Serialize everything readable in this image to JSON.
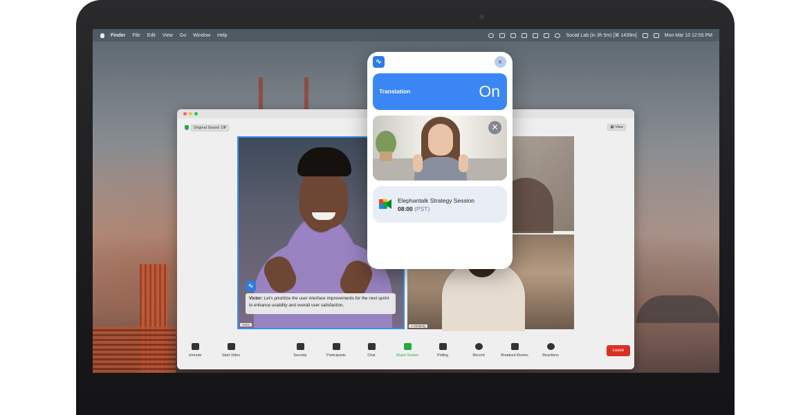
{
  "menubar": {
    "items": [
      "Finder",
      "File",
      "Edit",
      "View",
      "Go",
      "Window",
      "Help"
    ],
    "status_text": "Social Lab (in 3h 5m) [⌘ 1439m]",
    "datetime": "Mon Mar 10  12:55 PM"
  },
  "zoom": {
    "original_sound": "Original Sound: Off",
    "view_label": "View",
    "caption": {
      "speaker": "Victor:",
      "text": "Let's prioritize the user interface improvements for the next sprint to enhance usability and overall user satisfaction."
    },
    "name_tags": [
      "Victor",
      "Kimberly"
    ],
    "toolbar": {
      "unmute": "Unmute",
      "start_video": "Start Video",
      "security": "Security",
      "participants": "Participants",
      "chat": "Chat",
      "share_screen": "Share Screen",
      "polling": "Polling",
      "record": "Record",
      "breakout_rooms": "Breakout Rooms",
      "reactions": "Reactions",
      "leave": "Leave"
    }
  },
  "widget": {
    "avatar_initial": "K",
    "translation_label": "Translation",
    "translation_state": "On",
    "meeting_title": "Elephantalk Strategy Session",
    "meeting_time": "08:00",
    "meeting_tz": "(PST)"
  },
  "colors": {
    "accent_blue": "#3a86f5",
    "leave_red": "#d93025",
    "share_green": "#27a843"
  }
}
